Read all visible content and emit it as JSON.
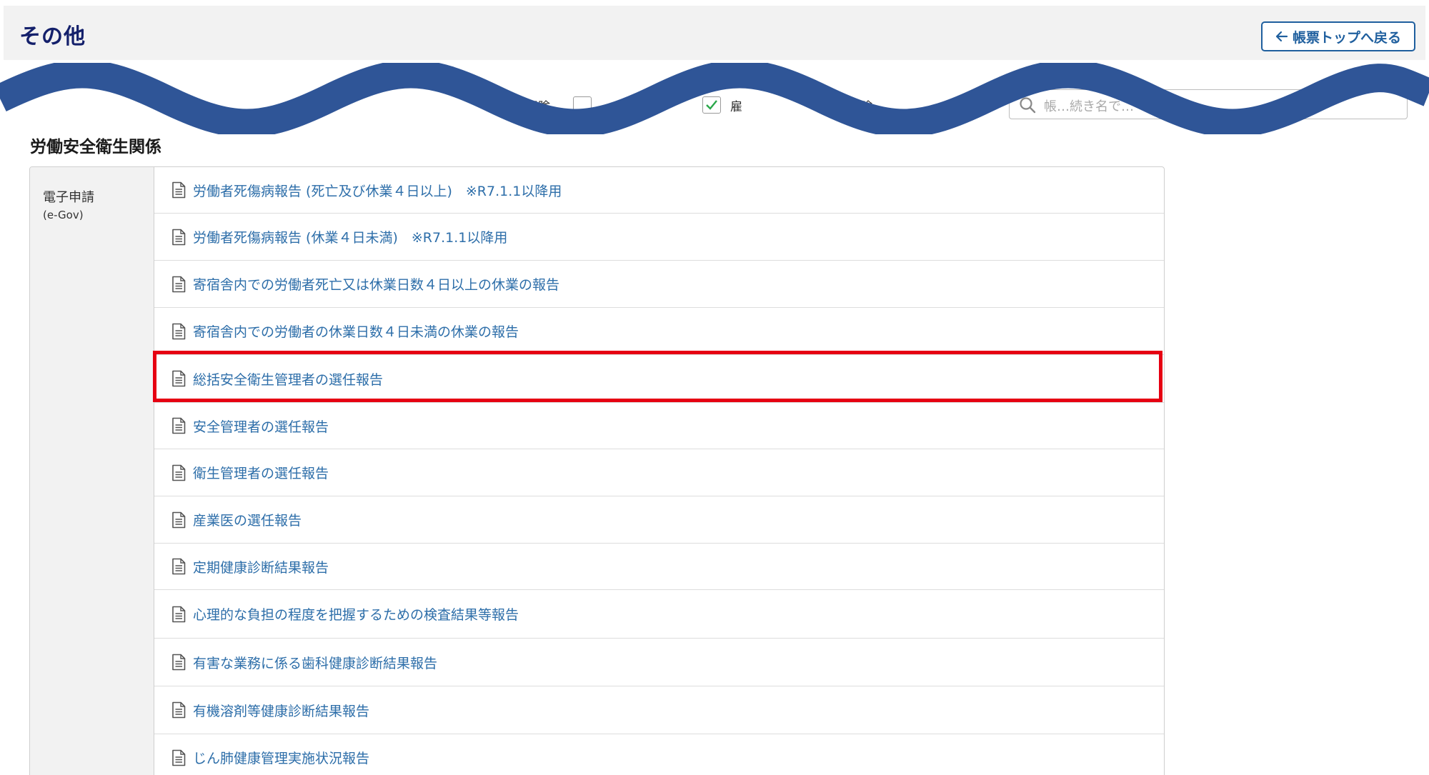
{
  "header": {
    "title": "その他",
    "back_label": "帳票トップへ戻る",
    "back_icon": "arrow-left-icon"
  },
  "filters": {
    "items": [
      {
        "label": "保険",
        "checked": false
      },
      {
        "label": "雇",
        "checked": true
      },
      {
        "label": "働保険",
        "checked": false
      }
    ],
    "search_placeholder": "帳…続き名で…",
    "search_icon": "search-icon"
  },
  "section": {
    "heading": "労働安全衛生関係",
    "category": {
      "label": "電子申請",
      "sub": "(e-Gov)"
    },
    "items": [
      {
        "label": "労働者死傷病報告 (死亡及び休業４日以上)　※R7.1.1以降用"
      },
      {
        "label": "労働者死傷病報告 (休業４日未満)　※R7.1.1以降用"
      },
      {
        "label": "寄宿舎内での労働者死亡又は休業日数４日以上の休業の報告"
      },
      {
        "label": "寄宿舎内での労働者の休業日数４日未満の休業の報告"
      },
      {
        "label": "総括安全衛生管理者の選任報告",
        "highlighted": true
      },
      {
        "label": "安全管理者の選任報告"
      },
      {
        "label": "衛生管理者の選任報告"
      },
      {
        "label": "産業医の選任報告"
      },
      {
        "label": "定期健康診断結果報告"
      },
      {
        "label": "心理的な負担の程度を把握するための検査結果等報告"
      },
      {
        "label": "有害な業務に係る歯科健康診断結果報告"
      },
      {
        "label": "有機溶剤等健康診断結果報告"
      },
      {
        "label": "じん肺健康管理実施状況報告"
      }
    ]
  },
  "colors": {
    "title": "#14206b",
    "link": "#2d6ea9",
    "highlight_border": "#e60012",
    "wave": "#2f5597"
  }
}
